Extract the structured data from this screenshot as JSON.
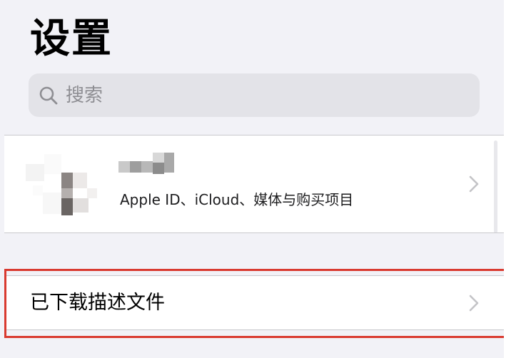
{
  "header": {
    "title": "设置"
  },
  "search": {
    "placeholder": "搜索",
    "icon": "search-icon"
  },
  "account": {
    "subtitle": "Apple ID、iCloud、媒体与购买项目",
    "avatar": "avatar-blurred",
    "name_obscured": true
  },
  "profile": {
    "label": "已下载描述文件"
  },
  "colors": {
    "background": "#f2f2f7",
    "cell": "#ffffff",
    "search_field": "#e3e3e8",
    "placeholder": "#8e8e93",
    "highlight": "#d93a30",
    "chevron": "#c4c4c7"
  }
}
